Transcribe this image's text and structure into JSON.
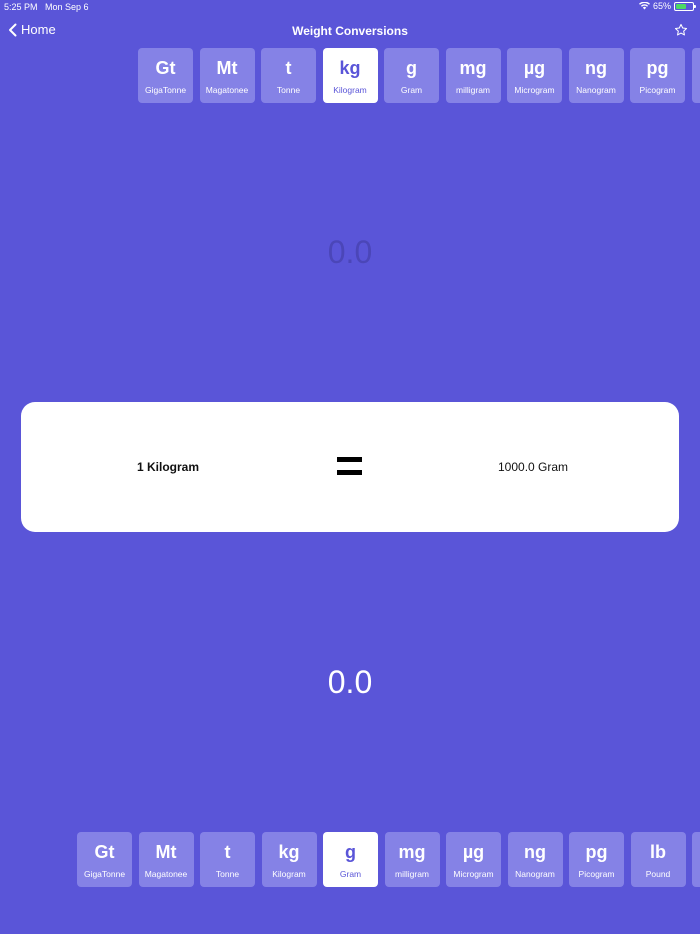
{
  "status_bar": {
    "time": "5:25 PM",
    "date": "Mon Sep 6",
    "battery": "65%",
    "battery_level": 0.65
  },
  "nav": {
    "back_label": "Home",
    "title": "Weight Conversions"
  },
  "from_units": [
    {
      "symbol": "Gt",
      "name": "GigaTonne"
    },
    {
      "symbol": "Mt",
      "name": "Magatonee"
    },
    {
      "symbol": "t",
      "name": "Tonne"
    },
    {
      "symbol": "kg",
      "name": "Kilogram",
      "selected": true
    },
    {
      "symbol": "g",
      "name": "Gram"
    },
    {
      "symbol": "mg",
      "name": "milligram"
    },
    {
      "symbol": "µg",
      "name": "Microgram"
    },
    {
      "symbol": "ng",
      "name": "Nanogram"
    },
    {
      "symbol": "pg",
      "name": "Picogram"
    }
  ],
  "to_units": [
    {
      "symbol": "Gt",
      "name": "GigaTonne"
    },
    {
      "symbol": "Mt",
      "name": "Magatonee"
    },
    {
      "symbol": "t",
      "name": "Tonne"
    },
    {
      "symbol": "kg",
      "name": "Kilogram"
    },
    {
      "symbol": "g",
      "name": "Gram",
      "selected": true
    },
    {
      "symbol": "mg",
      "name": "milligram"
    },
    {
      "symbol": "µg",
      "name": "Microgram"
    },
    {
      "symbol": "ng",
      "name": "Nanogram"
    },
    {
      "symbol": "pg",
      "name": "Picogram"
    },
    {
      "symbol": "lb",
      "name": "Pound"
    }
  ],
  "input_value": "0.0",
  "output_value": "0.0",
  "conversion": {
    "from": "1 Kilogram",
    "to": "1000.0 Gram"
  },
  "colors": {
    "background": "#5a55d8",
    "tile": "#8582e6",
    "selected_tile": "#ffffff",
    "battery_fill": "#4cd964"
  }
}
